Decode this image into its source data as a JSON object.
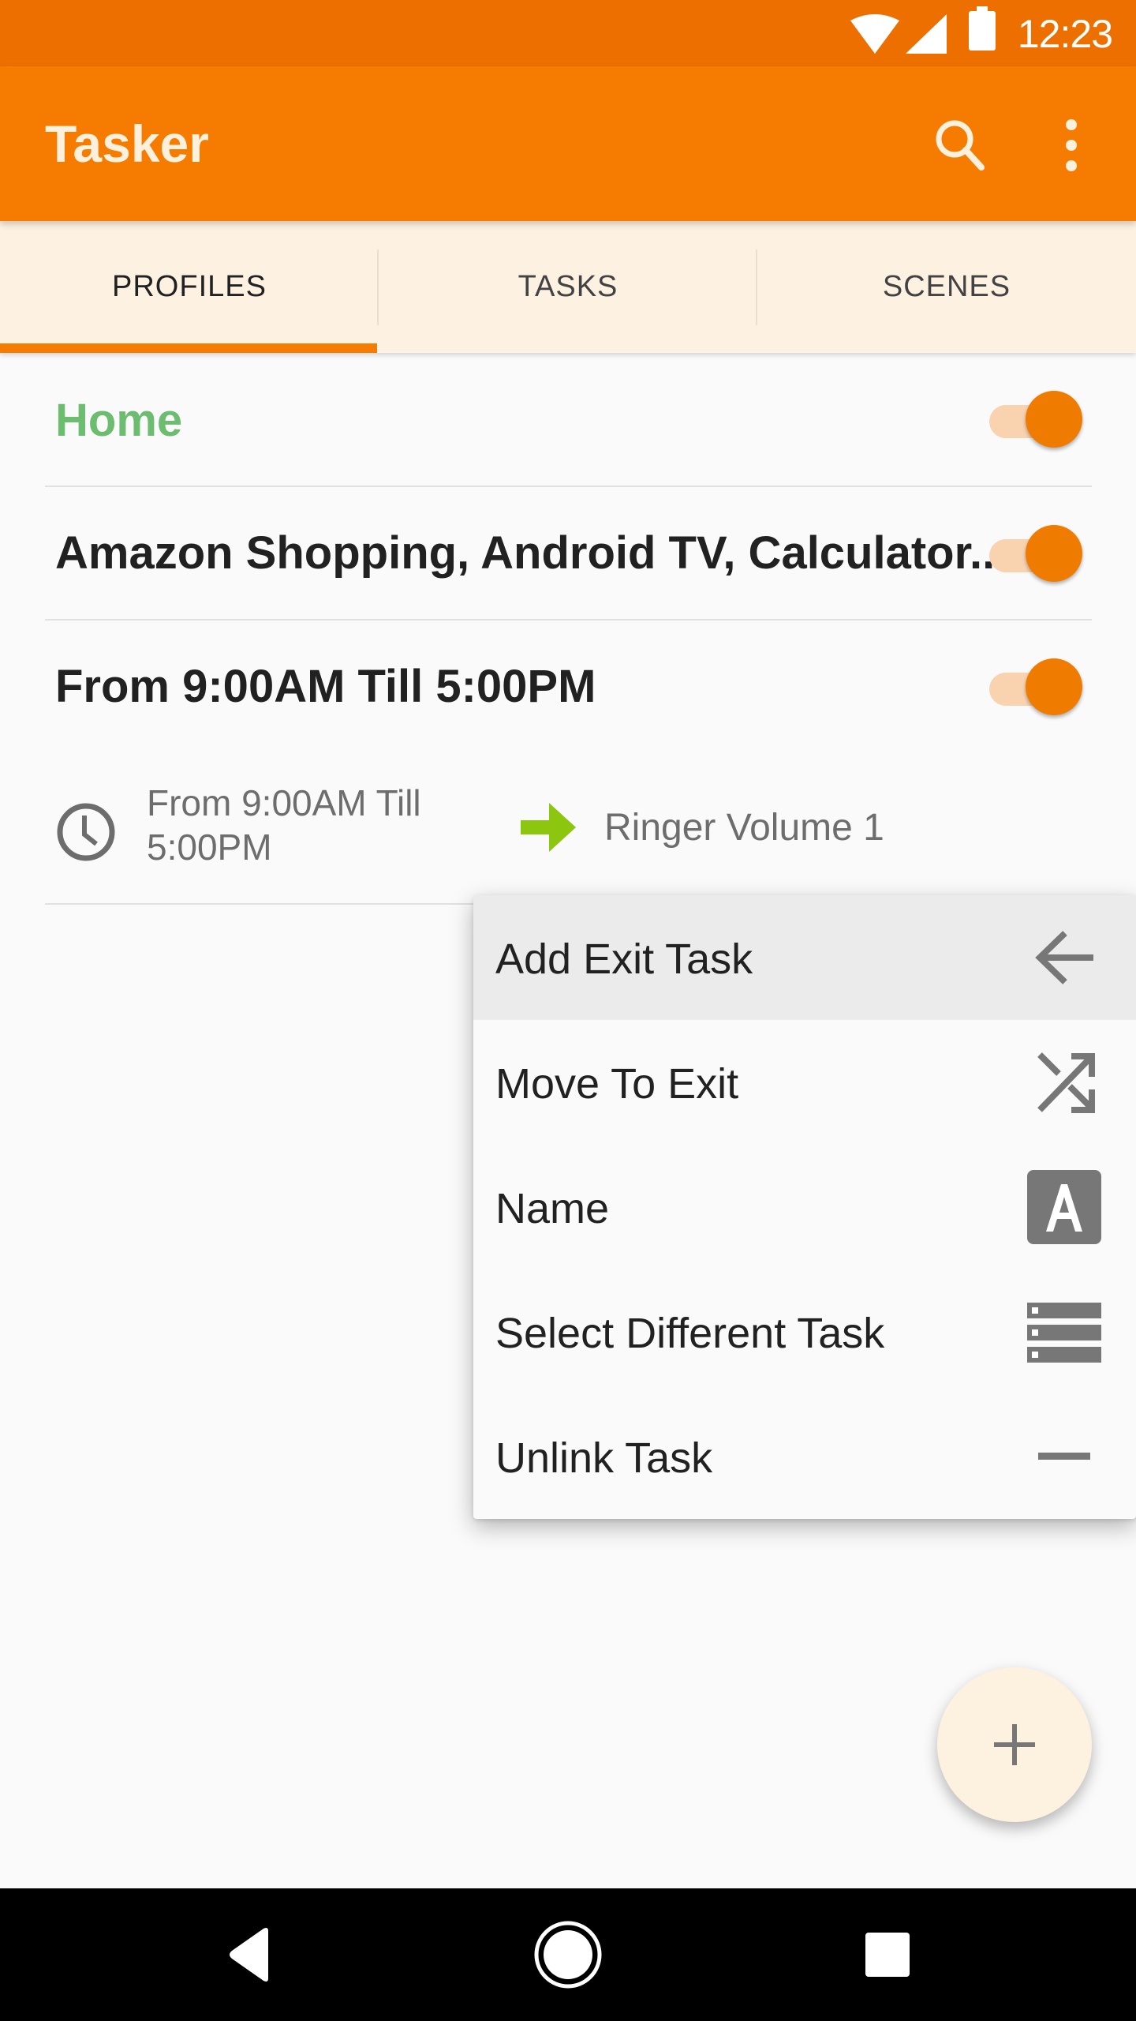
{
  "status_bar": {
    "time": "12:23",
    "icons": [
      "wifi-icon",
      "cell-signal-icon",
      "battery-icon"
    ]
  },
  "app_bar": {
    "title": "Tasker",
    "actions": [
      "search-icon",
      "more-vert-icon"
    ]
  },
  "tabs": [
    {
      "label": "PROFILES",
      "active": true
    },
    {
      "label": "TASKS",
      "active": false
    },
    {
      "label": "SCENES",
      "active": false
    }
  ],
  "profiles": [
    {
      "name": "Home",
      "enabled": true,
      "color": "#6cbd6f"
    },
    {
      "name": "Amazon Shopping, Android TV, Calculator..",
      "enabled": true
    },
    {
      "name": "From  9:00AM Till  5:00PM",
      "enabled": true,
      "expanded": {
        "context_icon": "clock-icon",
        "context_text": "From  9:00AM Till 5:00PM",
        "task_icon": "green-arrow-icon",
        "task_name": "Ringer Volume 1"
      }
    }
  ],
  "context_menu": {
    "items": [
      {
        "label": "Add Exit Task",
        "icon": "arrow-left-icon",
        "highlighted": true
      },
      {
        "label": "Move To Exit",
        "icon": "shuffle-icon"
      },
      {
        "label": "Name",
        "icon": "text-a-icon"
      },
      {
        "label": "Select Different Task",
        "icon": "list-icon"
      },
      {
        "label": "Unlink Task",
        "icon": "minus-icon"
      }
    ]
  },
  "fab": {
    "icon": "plus-icon"
  },
  "nav_bar": {
    "buttons": [
      "back-icon",
      "home-icon",
      "recents-icon"
    ]
  },
  "colors": {
    "status_bar": "#ec6f00",
    "app_bar": "#f57c00",
    "tab_bar": "#fdf2e2",
    "accent": "#ef7c00",
    "home_green": "#6cbd6f",
    "task_arrow_green": "#8cc60f"
  }
}
